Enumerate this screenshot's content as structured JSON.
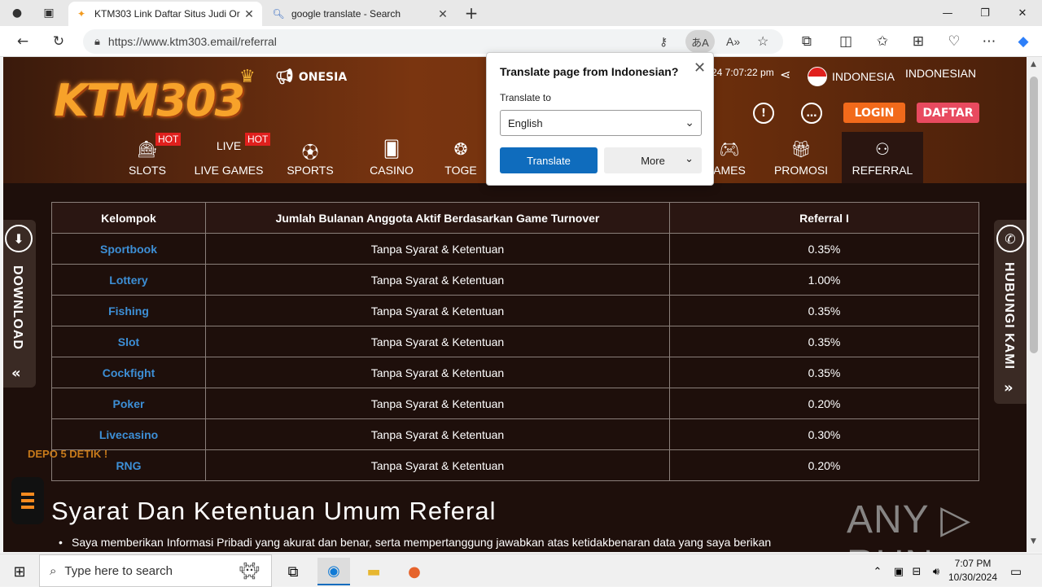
{
  "browser": {
    "tabs": [
      {
        "title": "KTM303 Link Daftar Situs Judi Or",
        "close": "✕"
      },
      {
        "title": "google translate - Search",
        "close": "✕"
      }
    ],
    "new_tab": "+",
    "url": "https://www.ktm303.email/referral",
    "window_controls": [
      "—",
      "❐",
      "✕"
    ]
  },
  "header": {
    "logo": "KTM303",
    "announcement": "ONESIA",
    "datetime": "24 7:07:22 pm",
    "country": "INDONESIA",
    "language": "INDONESIAN",
    "login": "LOGIN",
    "daftar": "DAFTAR"
  },
  "nav": [
    {
      "label": "SLOTS",
      "badge": "HOT"
    },
    {
      "label": "LIVE GAMES",
      "badge": "HOT"
    },
    {
      "label": "SPORTS",
      "badge": ""
    },
    {
      "label": "CASINO",
      "badge": ""
    },
    {
      "label": "TOGE",
      "badge": ""
    },
    {
      "label": "AMES",
      "badge": ""
    },
    {
      "label": "PROMOSI",
      "badge": ""
    },
    {
      "label": "REFERRAL",
      "badge": ""
    }
  ],
  "table": {
    "headers": [
      "Kelompok",
      "Jumlah Bulanan Anggota Aktif Berdasarkan Game Turnover",
      "Referral I"
    ],
    "rows": [
      [
        "Sportbook",
        "Tanpa Syarat & Ketentuan",
        "0.35%"
      ],
      [
        "Lottery",
        "Tanpa Syarat & Ketentuan",
        "1.00%"
      ],
      [
        "Fishing",
        "Tanpa Syarat & Ketentuan",
        "0.35%"
      ],
      [
        "Slot",
        "Tanpa Syarat & Ketentuan",
        "0.35%"
      ],
      [
        "Cockfight",
        "Tanpa Syarat & Ketentuan",
        "0.35%"
      ],
      [
        "Poker",
        "Tanpa Syarat & Ketentuan",
        "0.20%"
      ],
      [
        "Livecasino",
        "Tanpa Syarat & Ketentuan",
        "0.30%"
      ],
      [
        "RNG",
        "Tanpa Syarat & Ketentuan",
        "0.20%"
      ]
    ]
  },
  "sidebar": {
    "download": "DOWNLOAD",
    "contact": "HUBUNGI KAMI",
    "depo": "DEPO 5 DETIK !"
  },
  "content": {
    "section_title": "Syarat Dan Ketentuan Umum Referal",
    "bullet": "Saya memberikan Informasi Pribadi yang akurat dan benar, serta mempertanggung jawabkan atas ketidakbenaran data yang saya berikan"
  },
  "watermark": "ANY ▷ RUN",
  "translate_popup": {
    "title": "Translate page from Indonesian?",
    "label": "Translate to",
    "language": "English",
    "translate_btn": "Translate",
    "more_btn": "More"
  },
  "taskbar": {
    "search_placeholder": "Type here to search",
    "time": "7:07 PM",
    "date": "10/30/2024"
  }
}
